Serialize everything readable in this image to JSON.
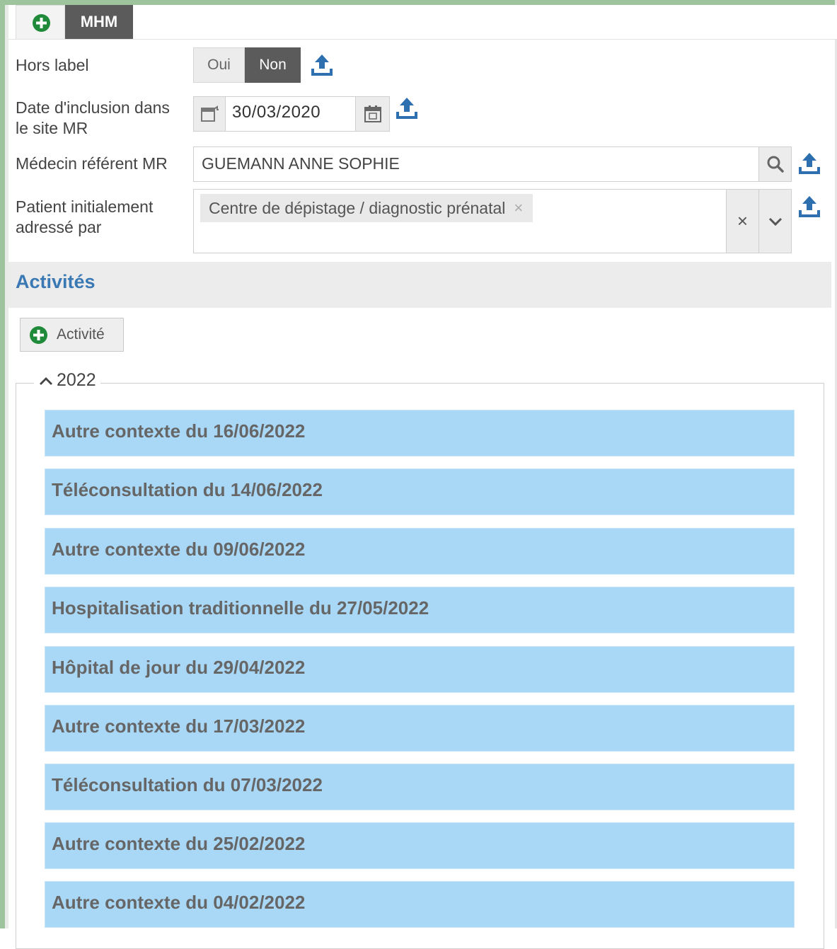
{
  "tabs": {
    "add_icon": "plus-circle-icon",
    "active_label": "MHM"
  },
  "form": {
    "hors_label": {
      "label": "Hors label",
      "options": [
        "Oui",
        "Non"
      ],
      "selected": "Non"
    },
    "date_inclusion": {
      "label_line1": "Date d'inclusion dans",
      "label_line2": "le site MR",
      "value": "30/03/2020"
    },
    "medecin": {
      "label": "Médecin référent MR",
      "value": "GUEMANN ANNE SOPHIE"
    },
    "adresse_par": {
      "label_line1": "Patient initialement",
      "label_line2": "adressé par",
      "selected": [
        "Centre de dépistage / diagnostic prénatal"
      ],
      "chip_remove": "×",
      "clear": "×"
    }
  },
  "activites": {
    "title": "Activités",
    "add_button": "Activité",
    "year": "2022",
    "items": [
      "Autre contexte du 16/06/2022",
      "Téléconsultation du 14/06/2022",
      "Autre contexte du 09/06/2022",
      "Hospitalisation traditionnelle du 27/05/2022",
      "Hôpital de jour du 29/04/2022",
      "Autre contexte du 17/03/2022",
      "Téléconsultation du 07/03/2022",
      "Autre contexte du 25/02/2022",
      "Autre contexte du 04/02/2022"
    ]
  },
  "colors": {
    "accent": "#3a79b4",
    "activity_bg": "#a9d8f7",
    "add_green": "#1f8a3a",
    "toggle_active": "#5b5b5b",
    "frame": "#9ec49e"
  }
}
